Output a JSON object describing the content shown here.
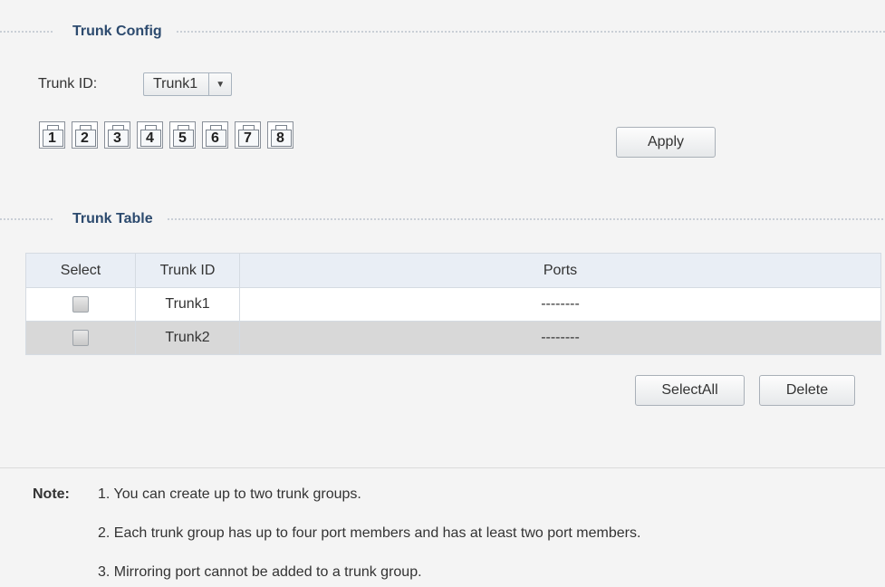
{
  "trunk_config": {
    "title": "Trunk Config",
    "trunk_id_label": "Trunk ID:",
    "trunk_id_selected": "Trunk1",
    "ports": [
      "1",
      "2",
      "3",
      "4",
      "5",
      "6",
      "7",
      "8"
    ],
    "apply_label": "Apply"
  },
  "trunk_table": {
    "title": "Trunk Table",
    "headers": {
      "select": "Select",
      "trunk_id": "Trunk ID",
      "ports": "Ports"
    },
    "rows": [
      {
        "trunk_id": "Trunk1",
        "ports": "--------"
      },
      {
        "trunk_id": "Trunk2",
        "ports": "--------"
      }
    ],
    "select_all_label": "SelectAll",
    "delete_label": "Delete"
  },
  "note": {
    "label": "Note:",
    "lines": [
      "1. You can create up to two trunk groups.",
      "2. Each trunk group has up to four port members and has at least two port members.",
      "3. Mirroring port cannot be added to a trunk group."
    ]
  },
  "colors": {
    "section_title": "#2c4a6e",
    "table_header_bg": "#e9eef5",
    "row_alt_bg": "#d8d8d8"
  }
}
